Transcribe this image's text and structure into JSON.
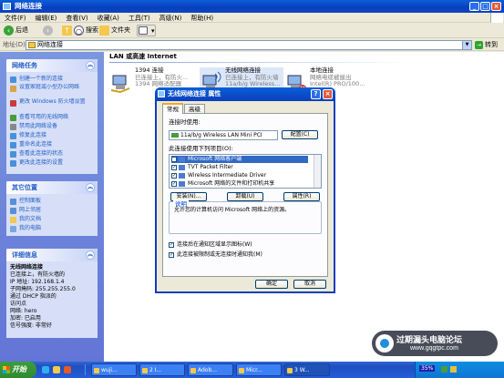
{
  "window": {
    "title": "网络连接",
    "caption_buttons": [
      "_",
      "□",
      "×"
    ]
  },
  "menu": [
    "文件(F)",
    "编辑(E)",
    "查看(V)",
    "收藏(A)",
    "工具(T)",
    "高级(N)",
    "帮助(H)"
  ],
  "toolbar": {
    "back": "后退",
    "search": "搜索",
    "folders": "文件夹"
  },
  "address": {
    "label": "地址(D)",
    "value": "网络连接",
    "go": "转到"
  },
  "network_tasks": {
    "title": "网络任务",
    "items": [
      "创建一个新的连接",
      "设置家庭或小型办公网络",
      "更改 Windows 防火墙设置",
      "查看可用的无线网络",
      "禁用此网络设备",
      "修复此连接",
      "重命名此连接",
      "查看此连接的状态",
      "更改此连接的设置"
    ]
  },
  "other_places": {
    "title": "其它位置",
    "items": [
      "控制面板",
      "网上邻居",
      "我的文档",
      "我的电脑"
    ]
  },
  "details": {
    "title": "详细信息",
    "name": "无线网络连接",
    "lines": [
      "已连接上，有防火墙的",
      "IP 地址: 192.168.1.4",
      "子网掩码: 255.255.255.0",
      "通过 DHCP 指派的",
      "访问点",
      "网络: hero",
      "加密: 已启用",
      "信号强度: 非常好"
    ]
  },
  "content": {
    "group_header": "LAN 或高速 Internet",
    "connections": [
      {
        "name": "1394 连接",
        "status": "已连接上，有防火...",
        "device": "1394 网络适配器"
      },
      {
        "name": "无线网络连接",
        "status": "已连接上，有防火墙",
        "device": "11a/b/g Wireless..."
      },
      {
        "name": "本地连接",
        "status": "网络电缆被拔出",
        "device": "Intel(R) PRO/100..."
      }
    ]
  },
  "dialog": {
    "title": "无线网络连接 属性",
    "tabs": [
      "常规",
      "高级"
    ],
    "connect_using_label": "连接时使用:",
    "adapter": "11a/b/g Wireless LAN Mini PCI",
    "configure": "配置(C)",
    "items_label": "此连接使用下列项目(O):",
    "components": [
      {
        "label": "Microsoft 网络客户端",
        "checked": "✓"
      },
      {
        "label": "TVT Packet Filter",
        "checked": "✓"
      },
      {
        "label": "Wireless Intermediate Driver",
        "checked": "✓"
      },
      {
        "label": "Microsoft 网络的文件和打印机共享",
        "checked": "✓"
      }
    ],
    "install": "安装(N)...",
    "uninstall": "卸载(U)",
    "properties": "属性(R)",
    "description_title": "说明",
    "description": "允许您的计算机访问 Microsoft 网络上的资源。",
    "show_icon": "连接后在通知区域显示图标(W)",
    "notify_limited": "此连接被限制或无连接时通知我(M)",
    "ok": "确定",
    "cancel": "取消"
  },
  "taskbar": {
    "start": "开始",
    "tasks": [
      "wuji...",
      "2 I...",
      "Adob...",
      "Micr...",
      "3 W..."
    ],
    "tray_text": "35%"
  },
  "watermark": {
    "title": "过期漏头电脑论坛",
    "url": "www.gqgtpc.com"
  }
}
